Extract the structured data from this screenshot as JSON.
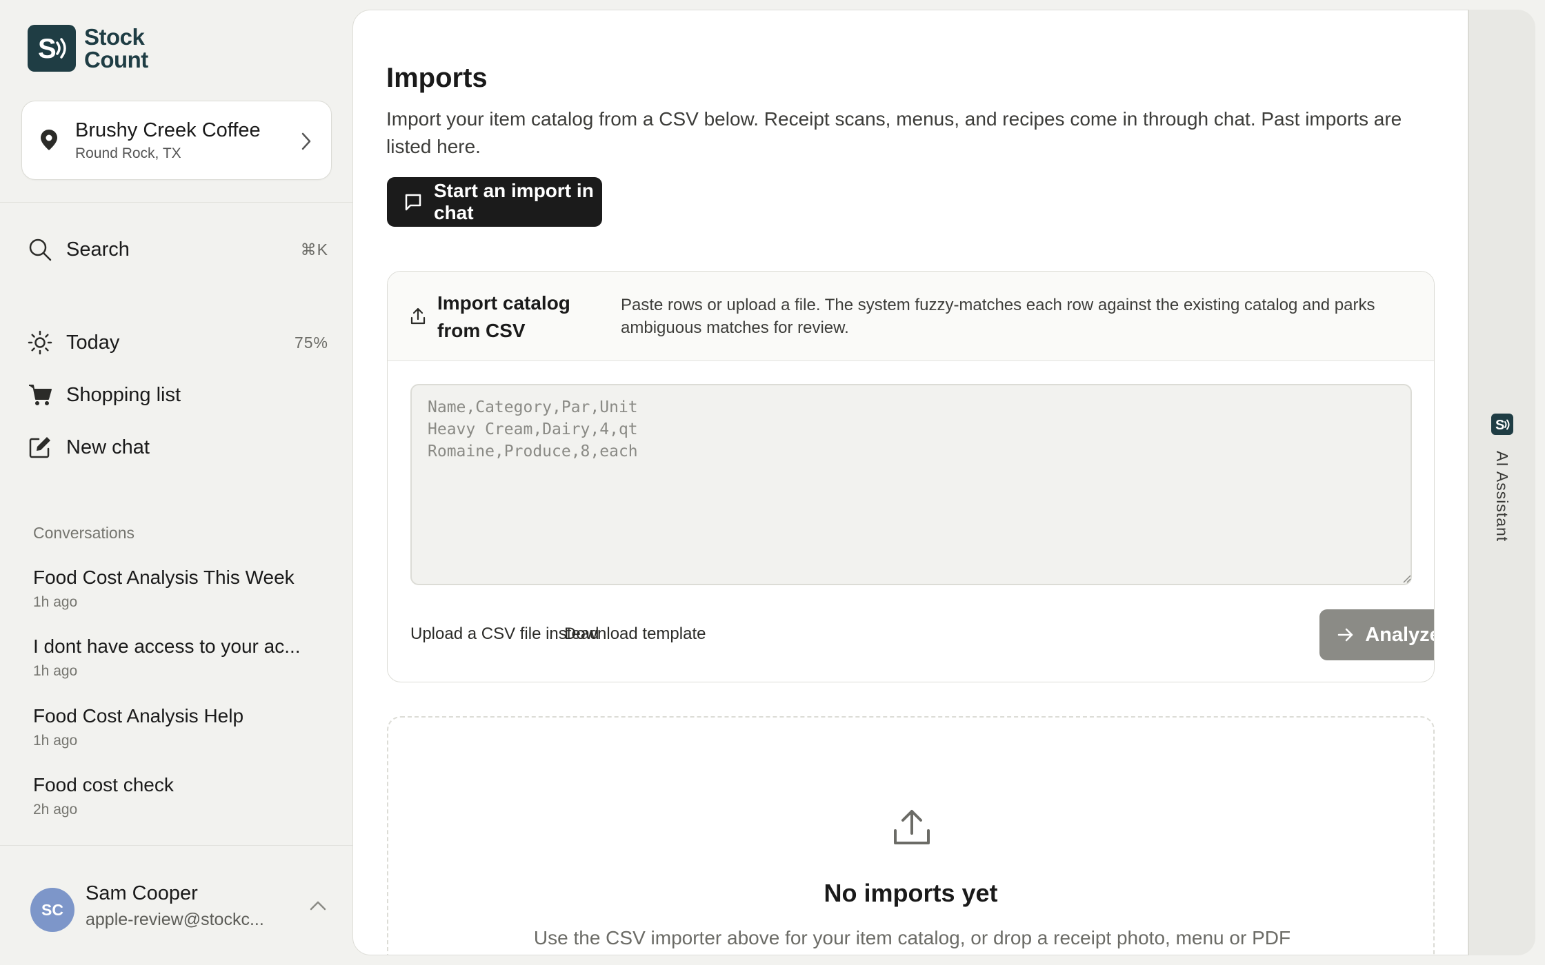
{
  "brand": {
    "line1": "Stock",
    "line2": "Count"
  },
  "location": {
    "name": "Brushy Creek Coffee",
    "sub": "Round Rock, TX"
  },
  "nav": {
    "search_label": "Search",
    "search_shortcut": "⌘K",
    "today_label": "Today",
    "today_meta": "75%",
    "shopping_label": "Shopping list",
    "newchat_label": "New chat"
  },
  "conversations": {
    "heading": "Conversations",
    "items": [
      {
        "title": "Food Cost Analysis This Week",
        "time": "1h ago"
      },
      {
        "title": "I dont have access to your ac...",
        "time": "1h ago"
      },
      {
        "title": "Food Cost Analysis Help",
        "time": "1h ago"
      },
      {
        "title": "Food cost check",
        "time": "2h ago"
      }
    ]
  },
  "user": {
    "initials": "SC",
    "name": "Sam Cooper",
    "email": "apple-review@stockc..."
  },
  "main": {
    "title": "Imports",
    "description": "Import your item catalog from a CSV below. Receipt scans, menus, and recipes come in through chat. Past imports are listed here.",
    "chat_button": "Start an import in chat",
    "csv": {
      "title": "Import catalog from CSV",
      "description": "Paste rows or upload a file. The system fuzzy-matches each row against the existing catalog and parks ambiguous matches for review.",
      "placeholder": "Name,Category,Par,Unit\nHeavy Cream,Dairy,4,qt\nRomaine,Produce,8,each",
      "upload_link": "Upload a CSV file instead",
      "template_link": "Download template",
      "analyze_button": "Analyze"
    },
    "empty": {
      "title": "No imports yet",
      "description": "Use the CSV importer above for your item catalog, or drop a receipt photo, menu or PDF invoice. Finished imports show up here."
    }
  },
  "assistant": {
    "label": "AI Assistant"
  },
  "colors": {
    "brand": "#1f3d44",
    "primary_button": "#1b1b1b",
    "disabled_button": "#8b8b86",
    "avatar": "#7d96c9"
  }
}
